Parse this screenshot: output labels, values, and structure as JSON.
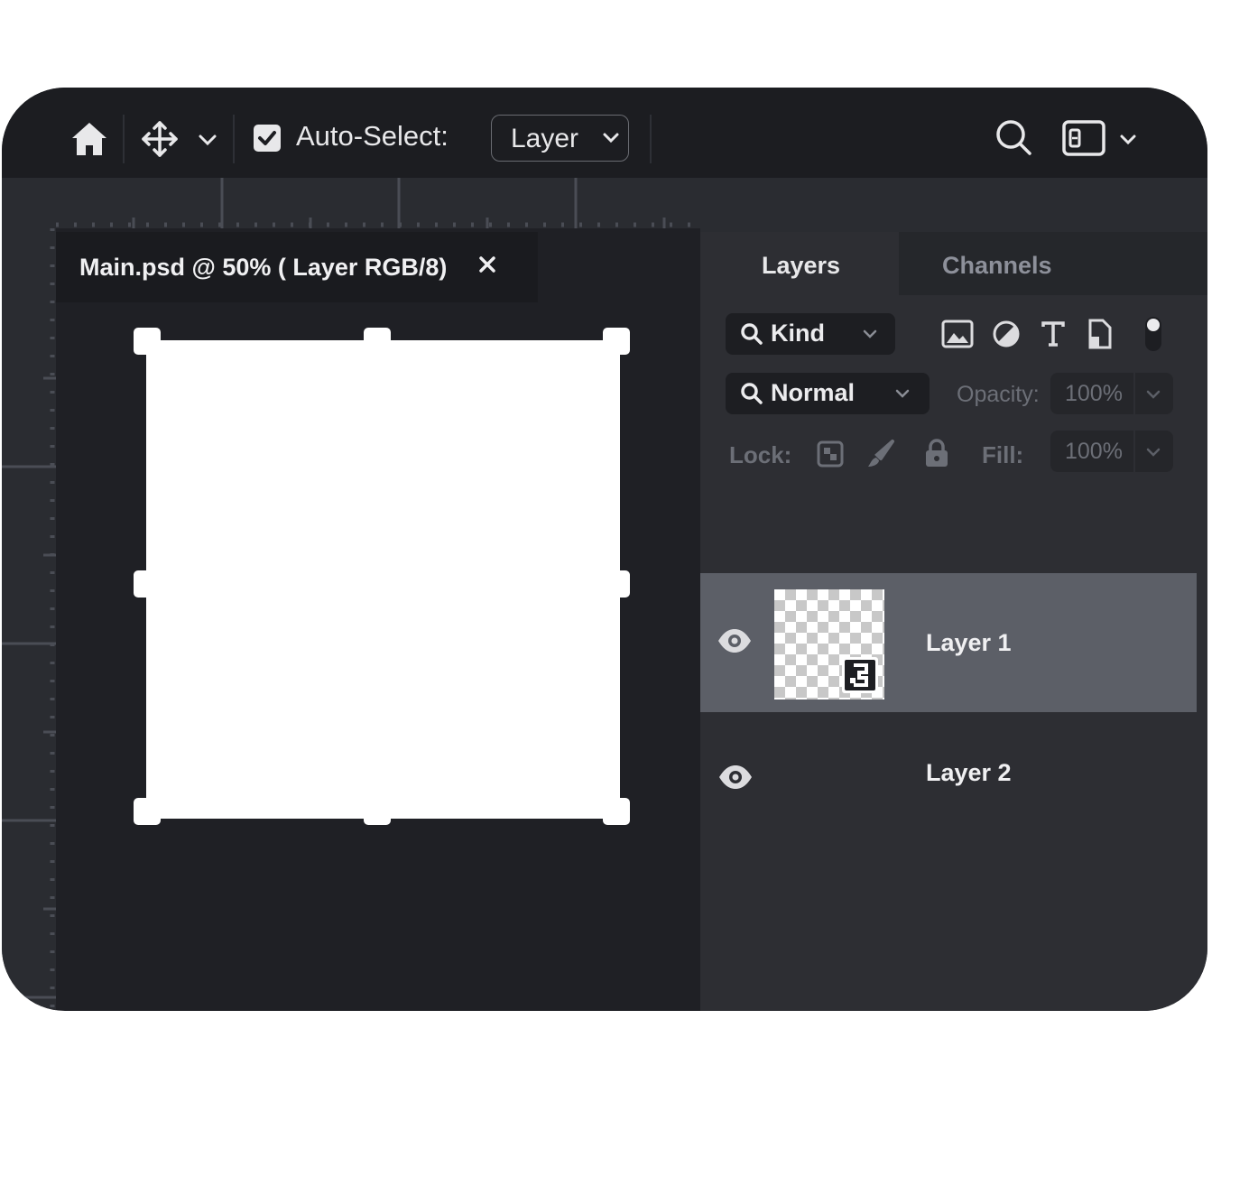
{
  "toolbar": {
    "home_icon": "home-icon",
    "move_icon": "move-icon",
    "auto_select_checked": true,
    "auto_select_label": "Auto-Select:",
    "auto_select_target": "Layer",
    "search_icon": "search-icon",
    "workspace_icon": "workspace-icon"
  },
  "document": {
    "tab_title": "Main.psd @ 50% ( Layer RGB/8)",
    "close_icon": "close-icon"
  },
  "panel": {
    "tabs": [
      {
        "label": "Layers",
        "active": true
      },
      {
        "label": "Channels",
        "active": false
      }
    ],
    "filter": {
      "label": "Kind"
    },
    "filter_icons": [
      "image-filter-icon",
      "adjustment-filter-icon",
      "type-filter-icon",
      "shape-filter-icon",
      "filter-toggle-icon"
    ],
    "blend_mode": "Normal",
    "opacity_label": "Opacity:",
    "opacity_value": "100%",
    "lock_label": "Lock:",
    "lock_icons": [
      "lock-transparent-icon",
      "lock-paint-icon",
      "lock-all-icon"
    ],
    "fill_label": "Fill:",
    "fill_value": "100%",
    "layers": [
      {
        "name": "Layer 1",
        "visible": true,
        "selected": true,
        "smart_object": true
      },
      {
        "name": "Layer 2",
        "visible": true,
        "selected": false
      }
    ],
    "footer_icons": [
      "add-mask-icon",
      "adjustment-layer-icon",
      "new-group-icon",
      "new-layer-icon",
      "delete-layer-icon"
    ]
  },
  "colors": {
    "window_bg": "#1f2025",
    "panel_bg": "#2d2e33",
    "selected_row": "#5c5f67",
    "canvas": "#ffffff"
  }
}
